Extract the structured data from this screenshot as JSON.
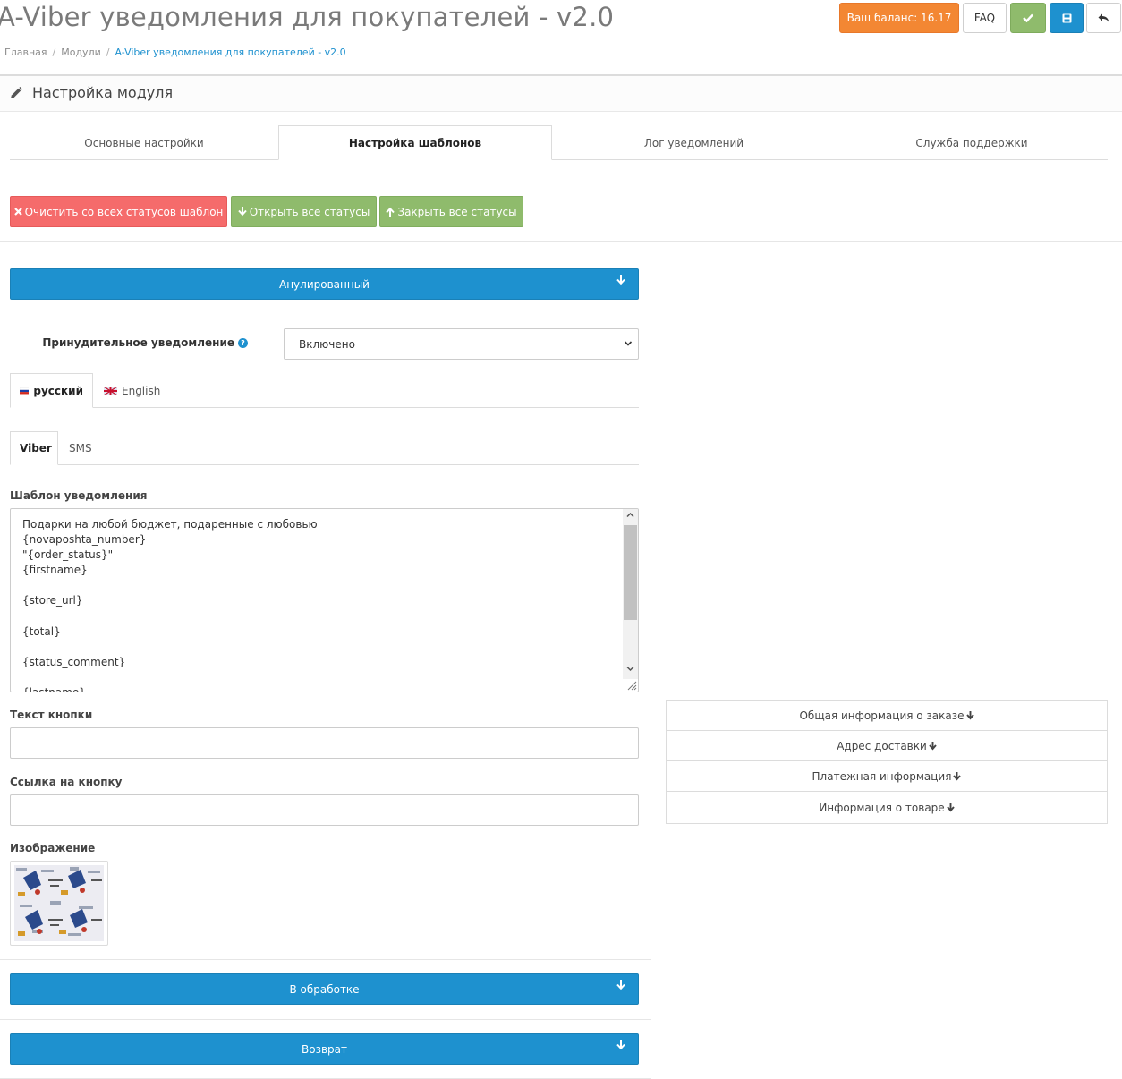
{
  "header": {
    "title": "A-Viber уведомления для покупателей - v2.0",
    "balance_label": "Ваш баланс: 16.17",
    "faq_label": "FAQ"
  },
  "breadcrumb": [
    "Главная",
    "Модули",
    "A-Viber уведомления для покупателей - v2.0"
  ],
  "panel": {
    "title": "Настройка модуля"
  },
  "tabs": [
    {
      "label": "Основные настройки",
      "active": false
    },
    {
      "label": "Настройка шаблонов",
      "active": true
    },
    {
      "label": "Лог уведомлений",
      "active": false
    },
    {
      "label": "Служба поддержки",
      "active": false
    }
  ],
  "actions": {
    "clear_label": "Очистить со всех статусов шаблон",
    "open_all_label": "Открыть все статусы",
    "close_all_label": "Закрыть все статусы"
  },
  "statuses": [
    "Анулированный",
    "В обработке",
    "Возврат"
  ],
  "forced": {
    "label": "Принудительное уведомление",
    "value": "Включено"
  },
  "languages": [
    {
      "label": "русский",
      "active": true
    },
    {
      "label": "English",
      "active": false
    }
  ],
  "channels": [
    {
      "label": "Viber",
      "active": true
    },
    {
      "label": "SMS",
      "active": false
    }
  ],
  "template": {
    "label": "Шаблон уведомления",
    "lines": [
      "Подарки на любой бюджет, подаренные с любовью",
      "{novaposhta_number}",
      "\"{order_status}\"",
      "{firstname}",
      "",
      "{store_url}",
      "",
      "{total}",
      "",
      "{status_comment}",
      "",
      "{lastname}"
    ]
  },
  "button_text": {
    "label": "Текст кнопки",
    "value": ""
  },
  "button_link": {
    "label": "Ссылка на кнопку",
    "value": ""
  },
  "image": {
    "label": "Изображение"
  },
  "info_items": [
    "Общая информация о заказе",
    "Адрес доставки",
    "Платежная информация",
    "Информация о товаре"
  ],
  "colors": {
    "primary": "#1e91cf",
    "success": "#8fbb6c",
    "danger": "#f56b6b",
    "warning": "#f38733"
  }
}
